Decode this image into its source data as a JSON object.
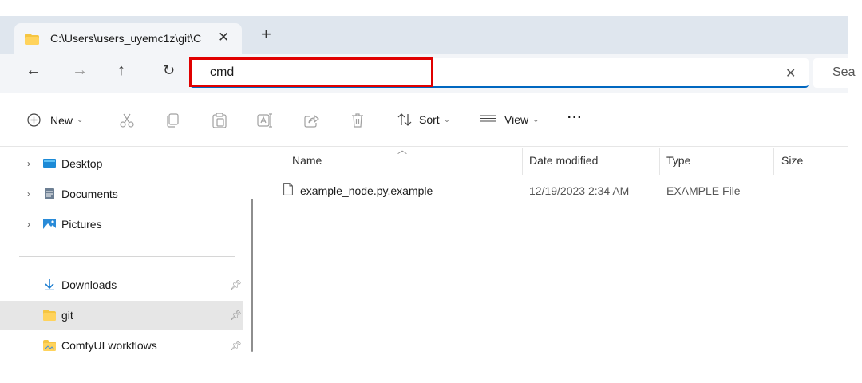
{
  "tab": {
    "title": "C:\\Users\\users_uyemc1z\\git\\C",
    "close_glyph": "✕",
    "new_tab_glyph": "+"
  },
  "nav": {
    "back_glyph": "←",
    "forward_glyph": "→",
    "up_glyph": "↑",
    "refresh_glyph": "↻"
  },
  "address": {
    "value": "cmd",
    "clear_glyph": "✕"
  },
  "search": {
    "placeholder": "Sea"
  },
  "toolbar": {
    "new_label": "New",
    "sort_label": "Sort",
    "view_label": "View",
    "more_label": "···"
  },
  "sidebar": {
    "items": [
      {
        "label": "Desktop"
      },
      {
        "label": "Documents"
      },
      {
        "label": "Pictures"
      },
      {
        "label": "Downloads"
      },
      {
        "label": "git"
      },
      {
        "label": "ComfyUI workflows"
      }
    ]
  },
  "columns": {
    "name": "Name",
    "date": "Date modified",
    "type": "Type",
    "size": "Size"
  },
  "files": [
    {
      "name": "example_node.py.example",
      "date": "12/19/2023 2:34 AM",
      "type": "EXAMPLE File",
      "size": ""
    }
  ],
  "colors": {
    "accent": "#0067c0",
    "highlight": "#e00000",
    "folder": "#f5c542",
    "tab_strip": "#dfe6ee"
  }
}
